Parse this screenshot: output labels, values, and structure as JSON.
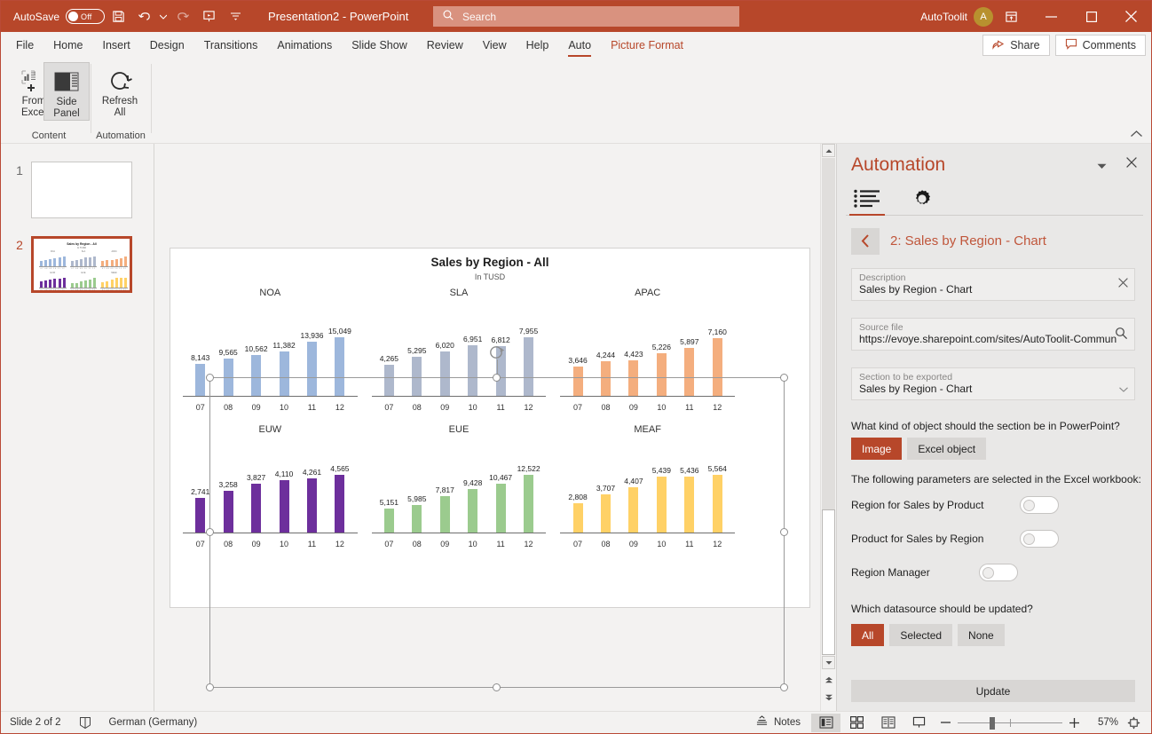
{
  "titlebar": {
    "autosave_label": "AutoSave",
    "autosave_state": "Off",
    "save_icon": "save-icon",
    "undo_icon": "undo-icon",
    "redo_icon": "redo-icon",
    "present_icon": "start-presentation-icon",
    "more_icon": "customize-quick-access-icon",
    "document_title": "Presentation2  -  PowerPoint",
    "search_placeholder": "Search",
    "search_icon": "search-icon",
    "account_name": "AutoToolit",
    "account_initial": "A",
    "ribbon_display_icon": "ribbon-display-options-icon",
    "minimize_icon": "minimize-icon",
    "maximize_icon": "maximize-icon",
    "close_icon": "close-icon"
  },
  "ribbon": {
    "tabs": [
      {
        "label": "File",
        "state": "normal"
      },
      {
        "label": "Home",
        "state": "normal"
      },
      {
        "label": "Insert",
        "state": "normal"
      },
      {
        "label": "Design",
        "state": "normal"
      },
      {
        "label": "Transitions",
        "state": "normal"
      },
      {
        "label": "Animations",
        "state": "normal"
      },
      {
        "label": "Slide Show",
        "state": "normal"
      },
      {
        "label": "Review",
        "state": "normal"
      },
      {
        "label": "View",
        "state": "normal"
      },
      {
        "label": "Help",
        "state": "normal"
      },
      {
        "label": "Auto",
        "state": "active"
      },
      {
        "label": "Picture Format",
        "state": "contextual"
      }
    ],
    "share_label": "Share",
    "comments_label": "Comments",
    "collapse_icon": "collapse-ribbon-icon",
    "groups": [
      {
        "name": "Content",
        "buttons": [
          {
            "line1": "From",
            "line2": "Excel",
            "icon": "insert-chart-from-excel-icon",
            "selected": false
          },
          {
            "line1": "Side",
            "line2": "Panel",
            "icon": "side-panel-icon",
            "selected": true
          }
        ]
      },
      {
        "name": "Automation",
        "buttons": [
          {
            "line1": "Refresh",
            "line2": "All",
            "icon": "refresh-all-icon",
            "selected": false
          }
        ]
      }
    ]
  },
  "thumbnails": [
    {
      "number": "1",
      "active": false
    },
    {
      "number": "2",
      "active": true
    }
  ],
  "chart_data": {
    "type": "bar",
    "title": "Sales by Region - All",
    "subtitle": "In TUSD",
    "xlabel": "",
    "ylabel": "",
    "grid": false,
    "legend": "none",
    "categories": [
      "07",
      "08",
      "09",
      "10",
      "11",
      "12"
    ],
    "panels": [
      {
        "name": "NOA",
        "color": "#9DB7DC",
        "values": [
          8143,
          9565,
          10562,
          11382,
          13936,
          15049
        ],
        "labels": [
          "8,143",
          "9,565",
          "10,562",
          "11,382",
          "13,936",
          "15,049"
        ],
        "ymax": 16000
      },
      {
        "name": "SLA",
        "color": "#AEB8CC",
        "values": [
          4265,
          5295,
          6020,
          6951,
          6812,
          7955
        ],
        "labels": [
          "4,265",
          "5,295",
          "6,020",
          "6,951",
          "6,812",
          "7,955"
        ],
        "ymax": 8500
      },
      {
        "name": "APAC",
        "color": "#F4AE7E",
        "values": [
          3646,
          4244,
          4423,
          5226,
          5897,
          7160
        ],
        "labels": [
          "3,646",
          "4,244",
          "4,423",
          "5,226",
          "5,897",
          "7,160"
        ],
        "ymax": 7700
      },
      {
        "name": "EUW",
        "color": "#6D2F9C",
        "values": [
          2741,
          3258,
          3827,
          4110,
          4261,
          4565
        ],
        "labels": [
          "2,741",
          "3,258",
          "3,827",
          "4,110",
          "4,261",
          "4,565"
        ],
        "ymax": 4900
      },
      {
        "name": "EUE",
        "color": "#9BCB8E",
        "values": [
          5151,
          5985,
          7817,
          9428,
          10467,
          12522
        ],
        "labels": [
          "5,151",
          "5,985",
          "7,817",
          "9,428",
          "10,467",
          "12,522"
        ],
        "ymax": 13400
      },
      {
        "name": "MEAF",
        "color": "#FFD166",
        "values": [
          2808,
          3707,
          4407,
          5439,
          5436,
          5564
        ],
        "labels": [
          "2,808",
          "3,707",
          "4,407",
          "5,439",
          "5,436",
          "5,564"
        ],
        "ymax": 6000
      }
    ]
  },
  "taskpane": {
    "title": "Automation",
    "collapse_icon": "task-pane-options-icon",
    "close_icon": "close-icon",
    "tabs": [
      {
        "name": "list-tab",
        "icon": "list-icon",
        "active": true
      },
      {
        "name": "settings-tab",
        "icon": "gear-icon",
        "active": false
      }
    ],
    "back_icon": "back-chevron-icon",
    "section_heading": "2: Sales by Region - Chart",
    "description": {
      "label": "Description",
      "value": "Sales by Region - Chart",
      "clear_icon": "clear-icon"
    },
    "source_file": {
      "label": "Source file",
      "value": "https://evoye.sharepoint.com/sites/AutoToolit-CommunityT",
      "browse_icon": "search-icon"
    },
    "section_to_export": {
      "label": "Section to be exported",
      "value": "Sales by Region - Chart",
      "dropdown_icon": "chevron-down-icon"
    },
    "object_kind_question": "What kind of object should the section be in PowerPoint?",
    "object_kind_options": [
      {
        "label": "Image",
        "selected": true
      },
      {
        "label": "Excel object",
        "selected": false
      }
    ],
    "parameters_intro": "The following parameters are selected in the Excel workbook:",
    "parameters": [
      {
        "label": "Region for Sales by Product",
        "on": false
      },
      {
        "label": "Product for Sales by Region",
        "on": false
      },
      {
        "label": "Region Manager",
        "on": false
      }
    ],
    "datasource_question": "Which datasource should be updated?",
    "datasource_options": [
      {
        "label": "All",
        "selected": true
      },
      {
        "label": "Selected",
        "selected": false
      },
      {
        "label": "None",
        "selected": false
      }
    ],
    "update_label": "Update"
  },
  "statusbar": {
    "slide_indicator": "Slide 2 of 2",
    "accessibility_icon": "accessibility-checker-icon",
    "language": "German (Germany)",
    "notes_label": "Notes",
    "notes_icon": "notes-icon",
    "views": [
      {
        "name": "normal-view",
        "icon": "normal-view-icon",
        "active": true
      },
      {
        "name": "slide-sorter-view",
        "icon": "slide-sorter-icon",
        "active": false
      },
      {
        "name": "reading-view",
        "icon": "reading-view-icon",
        "active": false
      },
      {
        "name": "slideshow-view",
        "icon": "slideshow-icon",
        "active": false
      }
    ],
    "zoom_out_icon": "zoom-out-icon",
    "zoom_in_icon": "zoom-in-icon",
    "zoom_level": "57%",
    "fit_icon": "fit-slide-icon"
  },
  "colors": {
    "brand": "#b7472a",
    "titlebar": "#b7472a",
    "panel_bg": "#e9e8e7"
  }
}
